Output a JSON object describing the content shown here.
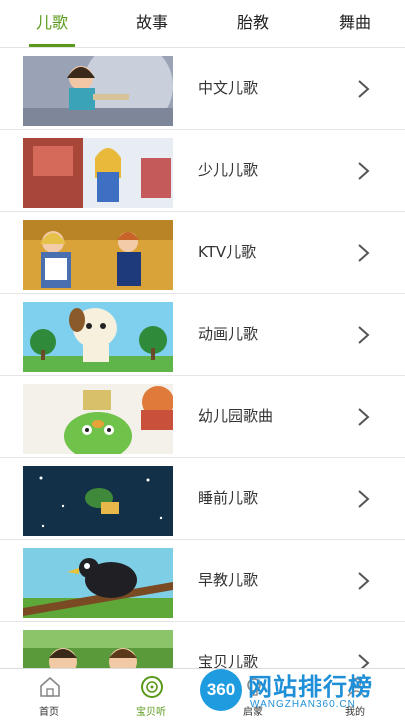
{
  "tabs": [
    {
      "label": "儿歌",
      "active": true
    },
    {
      "label": "故事",
      "active": false
    },
    {
      "label": "胎教",
      "active": false
    },
    {
      "label": "舞曲",
      "active": false
    }
  ],
  "list": [
    {
      "label": "中文儿歌"
    },
    {
      "label": "少儿儿歌"
    },
    {
      "label": "KTV儿歌"
    },
    {
      "label": "动画儿歌"
    },
    {
      "label": "幼儿园歌曲"
    },
    {
      "label": "睡前儿歌"
    },
    {
      "label": "早教儿歌"
    },
    {
      "label": "宝贝儿歌"
    }
  ],
  "bottom_nav": [
    {
      "label": "首页",
      "icon": "home-icon",
      "active": false
    },
    {
      "label": "宝贝听",
      "icon": "disc-icon",
      "active": true
    },
    {
      "label": "启蒙",
      "icon": "bulb-icon",
      "active": false
    },
    {
      "label": "我的",
      "icon": "user-icon",
      "active": false
    }
  ],
  "watermark": {
    "logo": "360",
    "text": "网站排行榜",
    "sub": "WANGZHAN360.CN"
  },
  "colors": {
    "accent": "#5a9a1a",
    "divider": "#e6e6e6",
    "watermark": "#1f8fd8"
  }
}
